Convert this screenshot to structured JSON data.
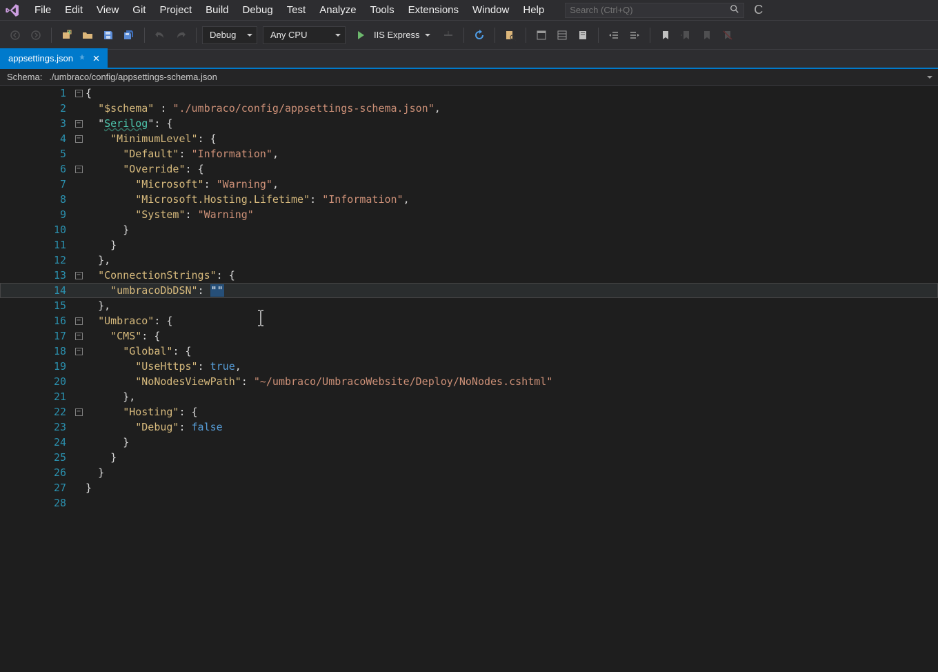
{
  "menubar": {
    "items": [
      "File",
      "Edit",
      "View",
      "Git",
      "Project",
      "Build",
      "Debug",
      "Test",
      "Analyze",
      "Tools",
      "Extensions",
      "Window",
      "Help"
    ],
    "search_placeholder": "Search (Ctrl+Q)"
  },
  "toolbar": {
    "config": "Debug",
    "platform": "Any CPU",
    "run_label": "IIS Express"
  },
  "tab": {
    "filename": "appsettings.json"
  },
  "schema": {
    "label": "Schema:",
    "path": "./umbraco/config/appsettings-schema.json"
  },
  "code": {
    "lines": [
      {
        "n": 1,
        "fold": true,
        "txt": "{"
      },
      {
        "n": 2,
        "fold": false,
        "txt": "  \"$schema\" : \"./umbraco/config/appsettings-schema.json\","
      },
      {
        "n": 3,
        "fold": true,
        "txt": "  \"Serilog\": {"
      },
      {
        "n": 4,
        "fold": true,
        "txt": "    \"MinimumLevel\": {"
      },
      {
        "n": 5,
        "fold": false,
        "txt": "      \"Default\": \"Information\","
      },
      {
        "n": 6,
        "fold": true,
        "txt": "      \"Override\": {"
      },
      {
        "n": 7,
        "fold": false,
        "txt": "        \"Microsoft\": \"Warning\","
      },
      {
        "n": 8,
        "fold": false,
        "txt": "        \"Microsoft.Hosting.Lifetime\": \"Information\","
      },
      {
        "n": 9,
        "fold": false,
        "txt": "        \"System\": \"Warning\""
      },
      {
        "n": 10,
        "fold": false,
        "txt": "      }"
      },
      {
        "n": 11,
        "fold": false,
        "txt": "    }"
      },
      {
        "n": 12,
        "fold": false,
        "txt": "  },"
      },
      {
        "n": 13,
        "fold": true,
        "txt": "  \"ConnectionStrings\": {"
      },
      {
        "n": 14,
        "fold": false,
        "txt": "    \"umbracoDbDSN\": \"\"",
        "current": true,
        "sel": true
      },
      {
        "n": 15,
        "fold": false,
        "txt": "  },"
      },
      {
        "n": 16,
        "fold": true,
        "txt": "  \"Umbraco\": {"
      },
      {
        "n": 17,
        "fold": true,
        "txt": "    \"CMS\": {"
      },
      {
        "n": 18,
        "fold": true,
        "txt": "      \"Global\": {"
      },
      {
        "n": 19,
        "fold": false,
        "txt": "        \"UseHttps\": true,"
      },
      {
        "n": 20,
        "fold": false,
        "txt": "        \"NoNodesViewPath\": \"~/umbraco/UmbracoWebsite/Deploy/NoNodes.cshtml\""
      },
      {
        "n": 21,
        "fold": false,
        "txt": "      },"
      },
      {
        "n": 22,
        "fold": true,
        "txt": "      \"Hosting\": {"
      },
      {
        "n": 23,
        "fold": false,
        "txt": "        \"Debug\": false"
      },
      {
        "n": 24,
        "fold": false,
        "txt": "      }"
      },
      {
        "n": 25,
        "fold": false,
        "txt": "    }"
      },
      {
        "n": 26,
        "fold": false,
        "txt": "  }"
      },
      {
        "n": 27,
        "fold": false,
        "txt": "}"
      },
      {
        "n": 28,
        "fold": false,
        "txt": ""
      }
    ],
    "serilog_key": "Serilog",
    "highlighted_line": 14,
    "selected_text": "\"\"",
    "cursor_line": 16
  }
}
